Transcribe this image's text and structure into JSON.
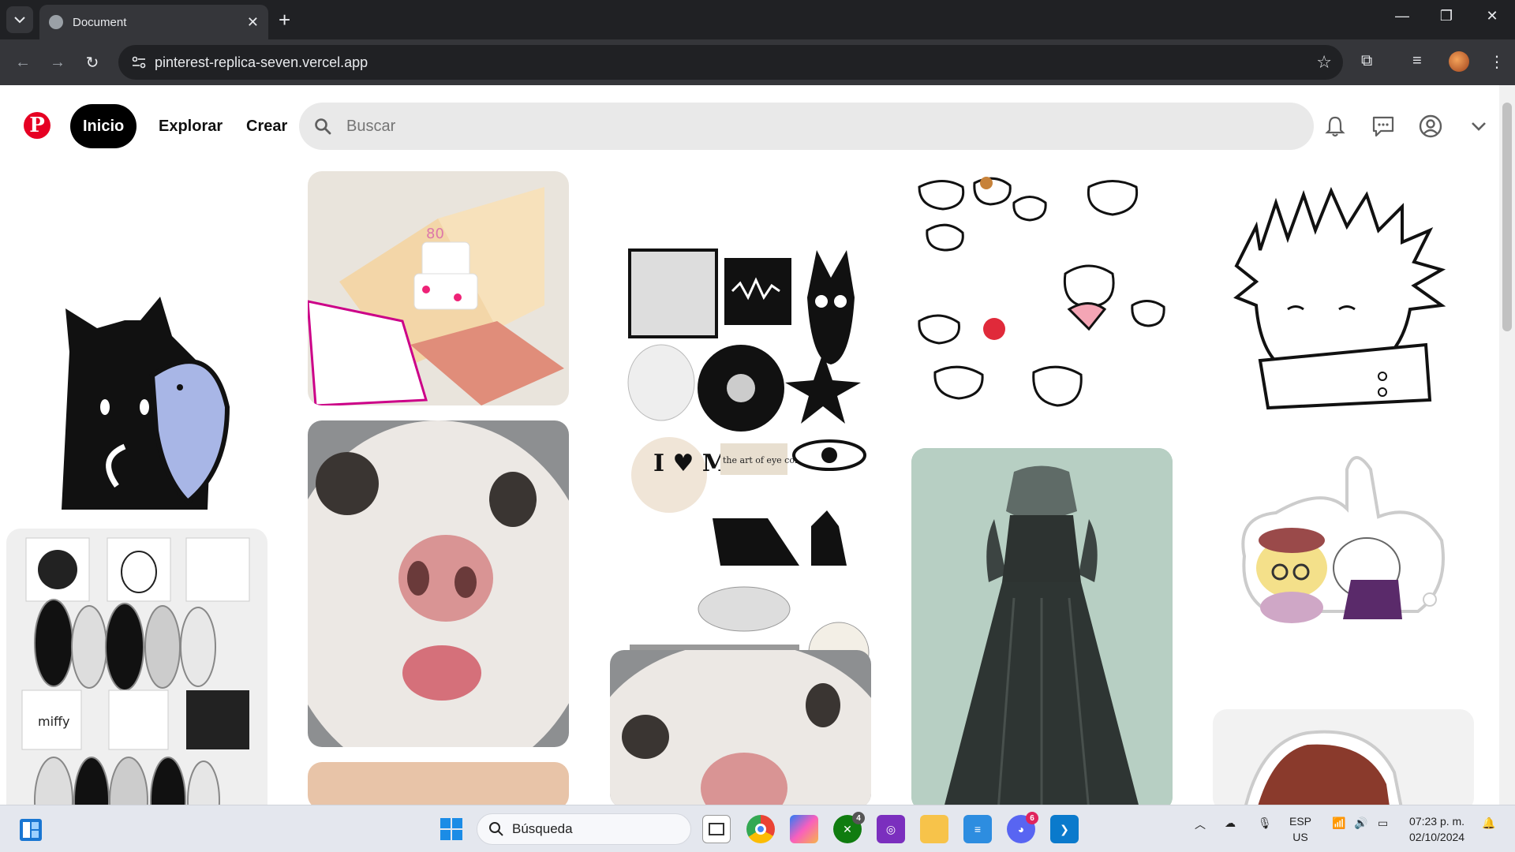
{
  "browser": {
    "tab_title": "Document",
    "url": "pinterest-replica-seven.vercel.app"
  },
  "header": {
    "logo": "P",
    "nav_home": "Inicio",
    "nav_explore": "Explorar",
    "nav_create": "Crear",
    "search_placeholder": "Buscar"
  },
  "pins": {
    "pop_up_card_text": "80",
    "sticker_text_1": "the art of eye contact",
    "sticker_text_2": "I ♥ ME",
    "nail_text": "miffy"
  },
  "taskbar": {
    "search_placeholder": "Búsqueda",
    "xbox_badge": "4",
    "discord_badge": "6",
    "lang_top": "ESP",
    "lang_bottom": "US",
    "time": "07:23 p. m.",
    "date": "02/10/2024"
  },
  "colors": {
    "brand": "#e60023",
    "chrome_dark": "#202124",
    "chrome_mid": "#35363a"
  }
}
